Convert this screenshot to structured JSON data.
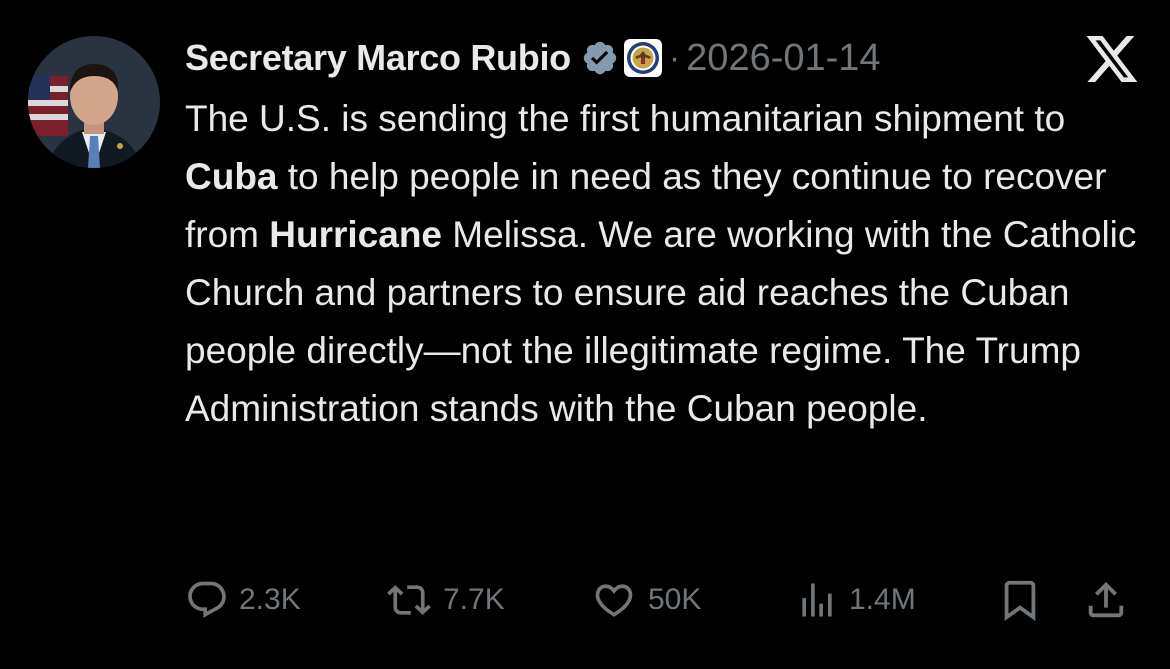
{
  "author": {
    "name": "Secretary Marco Rubio",
    "verified_icon": "verified-badge-icon",
    "affiliation_icon": "state-department-seal-icon"
  },
  "post": {
    "separator": "·",
    "date": "2026-01-14",
    "text_parts": [
      "The U.S. is sending the first humanitarian shipment to ",
      "Cuba",
      " to help people in need as they continue to recover from ",
      "Hurricane",
      " Melissa. We are working with the Catholic Church and partners to ensure aid reaches the Cuban people directly—not the illegitimate regime. The Trump Administration stands with the Cuban people."
    ]
  },
  "platform": {
    "logo": "x-logo-icon"
  },
  "actions": {
    "replies": "2.3K",
    "reposts": "7.7K",
    "likes": "50K",
    "views": "1.4M",
    "bookmark_icon": "bookmark-icon",
    "share_icon": "share-icon"
  },
  "colors": {
    "background": "#000000",
    "text": "#e7e9ea",
    "secondary": "#71767b",
    "verified": "#829aab"
  }
}
